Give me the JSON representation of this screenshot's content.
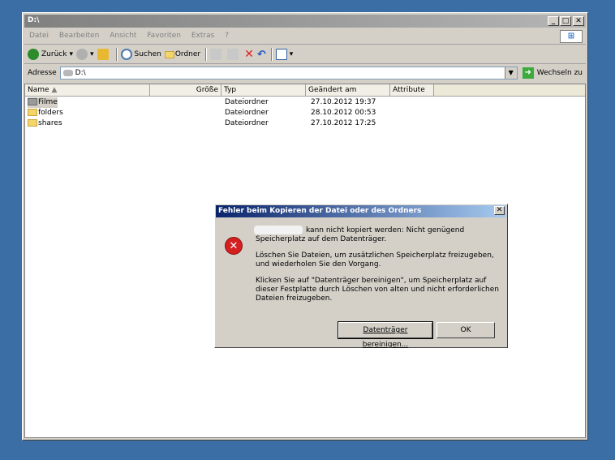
{
  "window": {
    "title": "D:\\",
    "controls": [
      "_",
      "□",
      "✕"
    ]
  },
  "menu": [
    "Datei",
    "Bearbeiten",
    "Ansicht",
    "Favoriten",
    "Extras",
    "?"
  ],
  "toolbar": {
    "back": "Zurück",
    "search": "Suchen",
    "folders": "Ordner"
  },
  "address": {
    "label": "Adresse",
    "value": "D:\\",
    "go": "Wechseln zu"
  },
  "columns": [
    "Name",
    "Größe",
    "Typ",
    "Geändert am",
    "Attribute"
  ],
  "rows": [
    {
      "name": "Filme",
      "type": "Dateiordner",
      "modified": "27.10.2012 19:37"
    },
    {
      "name": "folders",
      "type": "Dateiordner",
      "modified": "28.10.2012 00:53"
    },
    {
      "name": "shares",
      "type": "Dateiordner",
      "modified": "27.10.2012 17:25"
    }
  ],
  "dialog": {
    "title": "Fehler beim Kopieren der Datei oder des Ordners",
    "close": "✕",
    "line1": "kann nicht kopiert werden: Nicht genügend",
    "line2": "Speicherplatz auf dem Datenträger.",
    "para2": "Löschen Sie Dateien, um zusätzlichen Speicherplatz freizugeben, und wiederholen Sie den Vorgang.",
    "para3": "Klicken Sie auf \"Datenträger bereinigen\", um Speicherplatz auf dieser Festplatte durch Löschen von alten und nicht erforderlichen Dateien freizugeben.",
    "btn_cleanup": "Datenträger bereinigen...",
    "btn_ok": "OK"
  },
  "colors": {
    "desktop": "#3a6ea5",
    "dialog_title": "#0a246a",
    "error": "#d42020"
  }
}
